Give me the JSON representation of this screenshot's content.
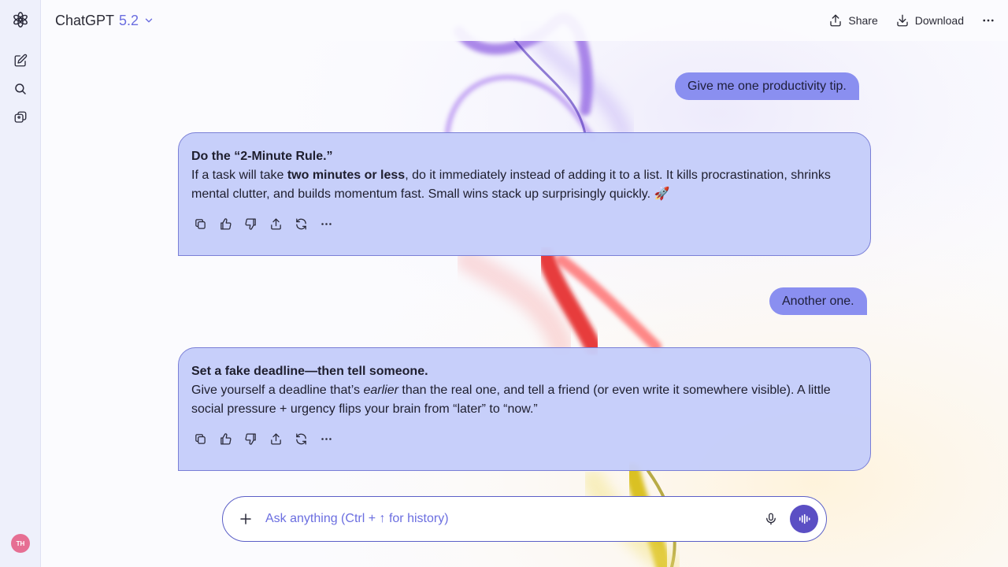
{
  "header": {
    "model_name": "ChatGPT",
    "model_version": "5.2",
    "share_label": "Share",
    "download_label": "Download"
  },
  "sidebar": {
    "avatar_initials": "TH"
  },
  "conversation": [
    {
      "role": "user",
      "text": "Give me one productivity tip."
    },
    {
      "role": "assistant",
      "title": "Do the “2-Minute Rule.”",
      "body_pre": "If a task will take ",
      "body_emph": "two minutes or less",
      "body_post": ", do it immediately instead of adding it to a list. It kills procrastination, shrinks mental clutter, and builds momentum fast. Small wins stack up surprisingly quickly. 🚀"
    },
    {
      "role": "user",
      "text": "Another one."
    },
    {
      "role": "assistant",
      "title": "Set a fake deadline—then tell someone.",
      "body_pre": "Give yourself a deadline that’s ",
      "body_emph": "earlier",
      "body_post": " than the real one, and tell a friend (or even write it somewhere visible). A little social pressure + urgency flips your brain from “later” to “now.”"
    }
  ],
  "message_actions": [
    "copy-icon",
    "thumbs-up-icon",
    "thumbs-down-icon",
    "share-icon",
    "regenerate-icon",
    "more-icon"
  ],
  "composer": {
    "placeholder": "Ask anything (Ctrl + ↑ for history)"
  },
  "colors": {
    "accent": "#5b4fc4",
    "user_bubble": "#8a8ff0",
    "assistant_card": "#c5cdfa"
  }
}
